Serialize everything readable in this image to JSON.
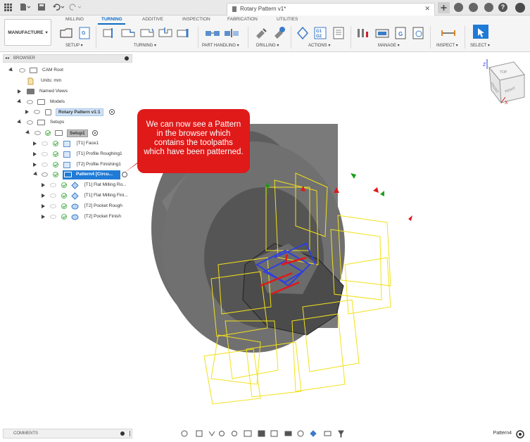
{
  "window": {
    "title": "Rotary Pattern v1*"
  },
  "workspace": {
    "label": "MANUFACTURE"
  },
  "ribbon_tabs": [
    "MILLING",
    "TURNING",
    "ADDITIVE",
    "INSPECTION",
    "FABRICATION",
    "UTILITIES"
  ],
  "active_tab": "TURNING",
  "ribbon_groups": [
    "SETUP",
    "TURNING",
    "PART HANDLING",
    "DRILLING",
    "ACTIONS",
    "MANAGE",
    "INSPECT",
    "SELECT"
  ],
  "browser": {
    "header": "BROWSER",
    "items": [
      {
        "label": "CAM Root"
      },
      {
        "label": "Units: mm"
      },
      {
        "label": "Named Views"
      },
      {
        "label": "Models"
      },
      {
        "label": "Rotary Pattern v1:1"
      },
      {
        "label": "Setups"
      },
      {
        "label": "Setup1"
      },
      {
        "label": "[T1] Face1"
      },
      {
        "label": "[T1] Profile Roughing1"
      },
      {
        "label": "[T2] Profile Finishing1"
      },
      {
        "label": "Pattern4 [Circu..."
      },
      {
        "label": "[T1] Flat Milling Ro..."
      },
      {
        "label": "[T1] Flat Milling Fini..."
      },
      {
        "label": "[T2] Pocket Rough"
      },
      {
        "label": "[T2] Pocket Finish"
      }
    ]
  },
  "callout": {
    "text": "We can now see a Pattern in the browser which contains the toolpaths which have been patterned."
  },
  "viewcube": {
    "top": "TOP",
    "front": "FRONT",
    "right": "RIGHT",
    "axis_z": "Z",
    "axis_x": "X"
  },
  "comments": {
    "label": "COMMENTS"
  },
  "status": {
    "selection": "Pattern4"
  },
  "colors": {
    "accent": "#0a6bc4",
    "callout": "#e01919",
    "selected_row": "#1f7bd6"
  }
}
